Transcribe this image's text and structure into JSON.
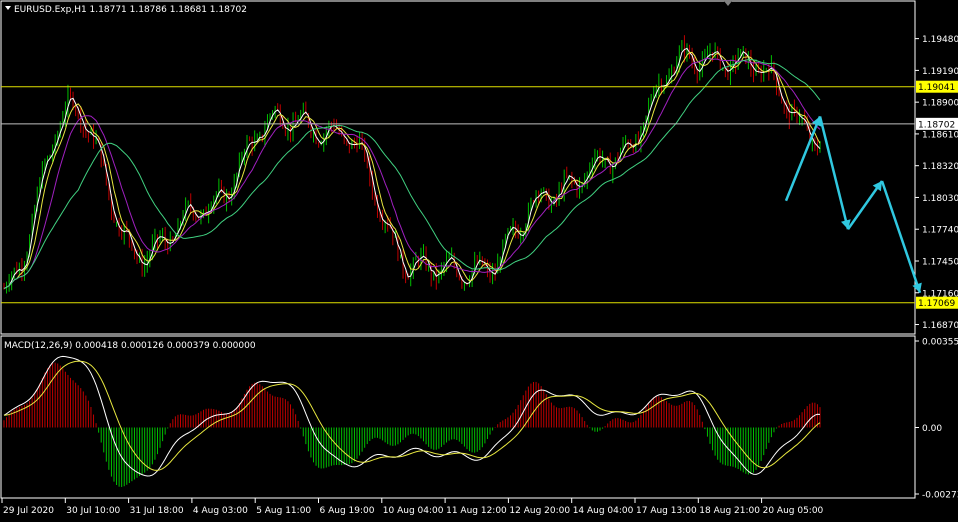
{
  "main_panel": {
    "header": "EURUSD.Exp,H1  1.18771 1.18786 1.18681 1.18702",
    "y_ticks": [
      "1.19480",
      "1.19190",
      "1.18900",
      "1.18610",
      "1.18320",
      "1.18030",
      "1.17740",
      "1.17450",
      "1.17160",
      "1.16870"
    ],
    "hlines": [
      {
        "price": "1.19041",
        "color": "#e0e000"
      },
      {
        "price": "1.18702",
        "color": "#c0c0c0"
      },
      {
        "price": "1.17069",
        "color": "#e0e000"
      }
    ]
  },
  "macd_panel": {
    "header": "MACD(12,26,9) 0.000418 0.000126 0.000379 0.000000",
    "y_ticks": [
      "0.003557",
      "0.00",
      "-0.002735"
    ]
  },
  "x_labels": [
    "29 Jul 2020",
    "30 Jul 10:00",
    "31 Jul 18:00",
    "4 Aug 03:00",
    "5 Aug 11:00",
    "6 Aug 19:00",
    "10 Aug 04:00",
    "11 Aug 12:00",
    "12 Aug 20:00",
    "14 Aug 04:00",
    "17 Aug 13:00",
    "18 Aug 21:00",
    "20 Aug 05:00"
  ],
  "colors": {
    "bull": "#00c000",
    "bear": "#c00000",
    "price_ma": "#ffffff",
    "ma_fast": "#e8e840",
    "ma_mid": "#a020c0",
    "ma_slow": "#40d080",
    "macd_line": "#ffffff",
    "signal_line": "#e8e840",
    "arrow": "#30c8e0",
    "axis": "#ffffff"
  },
  "chart_data": {
    "type": "line",
    "series": [
      {
        "x": [
          "29 Jul 2020",
          "30 Jul 10:00",
          "31 Jul 18:00",
          "4 Aug 03:00",
          "5 Aug 11:00",
          "6 Aug 19:00",
          "10 Aug 04:00",
          "11 Aug 12:00",
          "12 Aug 20:00",
          "14 Aug 04:00",
          "17 Aug 13:00",
          "18 Aug 21:00",
          "20 Aug 05:00"
        ],
        "values": [
          1.172,
          1.1885,
          1.175,
          1.1795,
          1.1875,
          1.186,
          1.174,
          1.1735,
          1.1805,
          1.184,
          1.193,
          1.1925,
          1.1855
        ]
      },
      {
        "x": [
          "29 Jul 2020",
          "30 Jul 10:00",
          "31 Jul 18:00",
          "4 Aug 03:00",
          "5 Aug 11:00",
          "6 Aug 19:00",
          "10 Aug 04:00",
          "11 Aug 12:00",
          "12 Aug 20:00",
          "14 Aug 04:00",
          "17 Aug 13:00",
          "18 Aug 21:00",
          "20 Aug 05:00"
        ],
        "values": [
          0.0005,
          0.003,
          -0.002,
          0.0003,
          0.002,
          -0.0015,
          -0.001,
          -0.0012,
          0.0015,
          0.0005,
          0.0015,
          -0.0018,
          0.0004
        ]
      }
    ],
    "ylim": [
      1.1682,
      1.1965
    ],
    "hlines": [
      1.19041,
      1.18702,
      1.17069
    ],
    "forecast_path": [
      {
        "x": "20 Aug 05:00",
        "y": 1.18
      },
      {
        "x": "20 Aug 05:00",
        "y": 1.1877
      },
      {
        "x": "after 20 Aug 05:00",
        "y": 1.1774
      },
      {
        "x": "after 20 Aug 05:00",
        "y": 1.1818
      },
      {
        "x": "after 20 Aug 05:00",
        "y": 1.1716
      }
    ],
    "macd_ylim": [
      -0.002735,
      0.003557
    ]
  }
}
